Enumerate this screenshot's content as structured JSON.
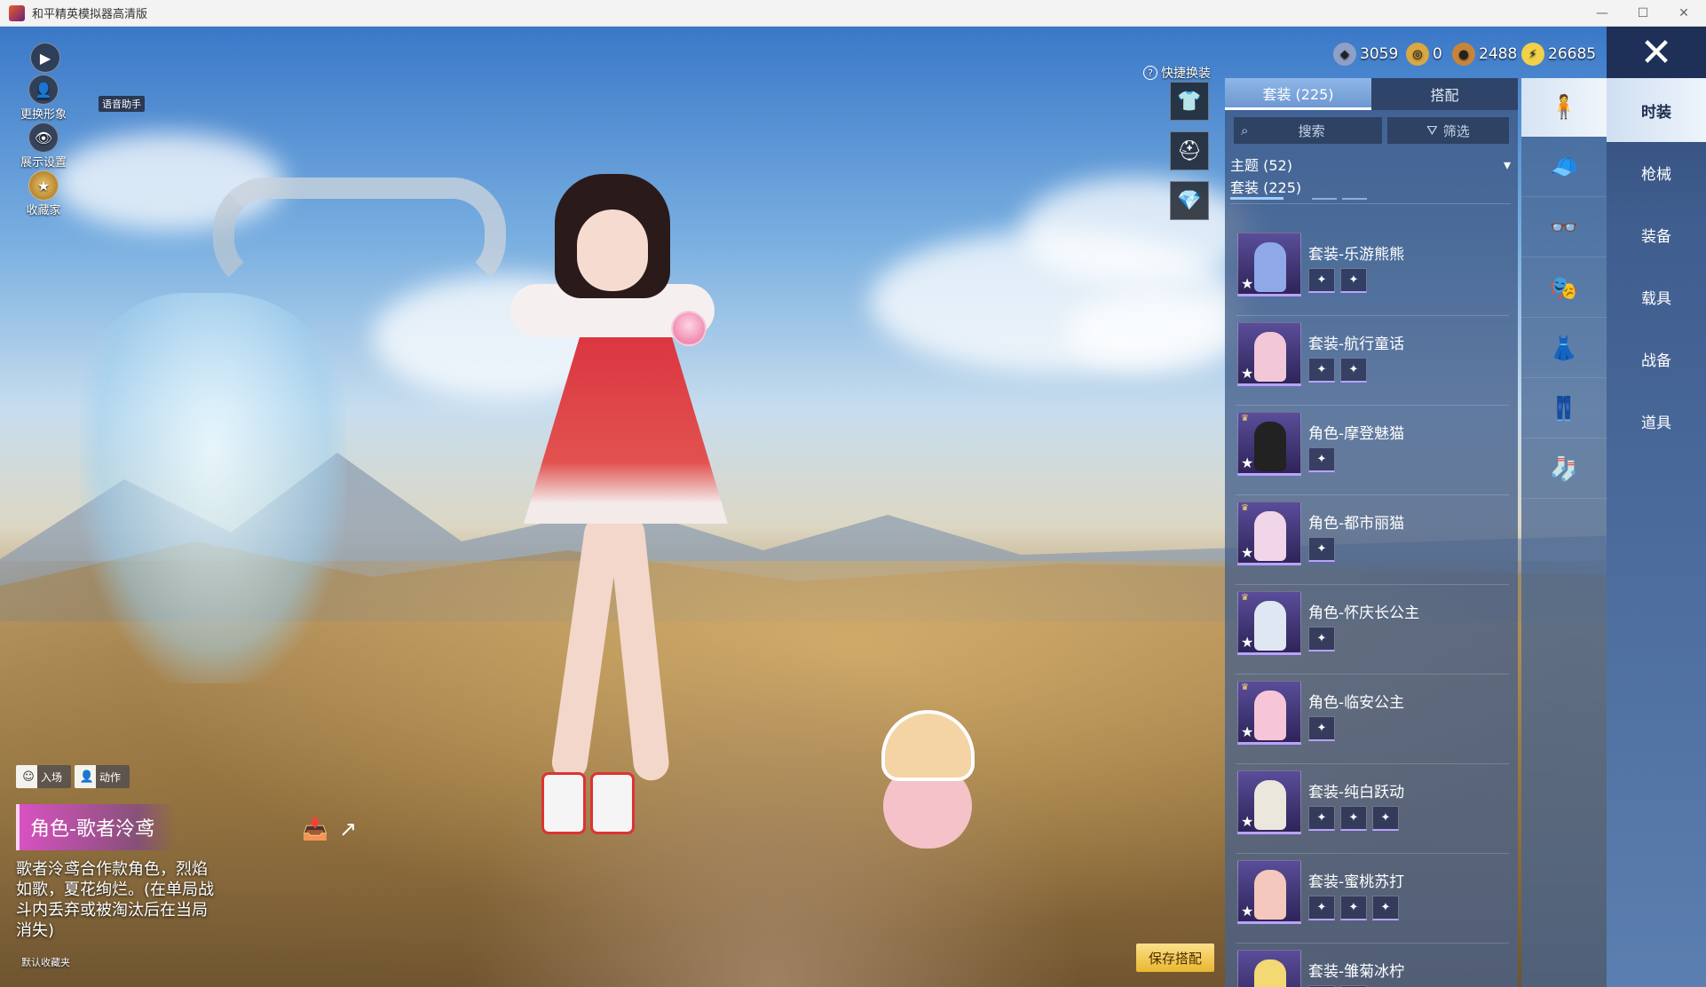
{
  "window": {
    "title": "和平精英模拟器高清版",
    "minimize": "—",
    "maximize": "☐",
    "close": "✕"
  },
  "left_hud": {
    "change_avatar": "更换形象",
    "display_settings": "展示设置",
    "collector": "收藏家",
    "voice_assistant": "语音助手"
  },
  "tags": {
    "entrance": "入场",
    "action": "动作"
  },
  "character": {
    "name": "角色-歌者泠鸢",
    "description": "歌者泠鸢合作款角色，烈焰如歌，夏花绚烂。(在单局战斗内丢弃或被淘汰后在当局消失)",
    "default_folder": "默认收藏夹"
  },
  "save_button": "保存搭配",
  "quick_change": {
    "label": "快捷换装",
    "icons": [
      "shirt-icon",
      "helmet-icon",
      "diamond-icon"
    ]
  },
  "currency": [
    {
      "icon": "silver-coin-icon",
      "value": "3059",
      "color": "#8fa0c8"
    },
    {
      "icon": "badge-coin-icon",
      "value": "0",
      "color": "#d8a842"
    },
    {
      "icon": "bronze-coin-icon",
      "value": "2488",
      "color": "#c8843a"
    },
    {
      "icon": "lightning-coin-icon",
      "value": "26685",
      "color": "#f2d04a"
    }
  ],
  "panel": {
    "tabs": [
      "套装 (225)",
      "搭配"
    ],
    "search_placeholder": "搜索",
    "filter_label": "筛选",
    "theme_label": "主题 (52)",
    "suit_label": "套装 (225)",
    "items": [
      {
        "title": "套装-乐游熊熊",
        "color": "#8fa8e8",
        "subicons": 2,
        "crown": false
      },
      {
        "title": "套装-航行童话",
        "color": "#f2c7d8",
        "subicons": 2,
        "crown": false
      },
      {
        "title": "角色-摩登魅猫",
        "color": "#222222",
        "subicons": 1,
        "crown": true
      },
      {
        "title": "角色-都市丽猫",
        "color": "#f0d6e8",
        "subicons": 1,
        "crown": true
      },
      {
        "title": "角色-怀庆长公主",
        "color": "#dfe7f3",
        "subicons": 1,
        "crown": true
      },
      {
        "title": "角色-临安公主",
        "color": "#f6c6d8",
        "subicons": 1,
        "crown": true
      },
      {
        "title": "套装-纯白跃动",
        "color": "#ece7dc",
        "subicons": 3,
        "crown": false
      },
      {
        "title": "套装-蜜桃苏打",
        "color": "#f4c8bc",
        "subicons": 3,
        "crown": false
      },
      {
        "title": "套装-雏菊冰柠",
        "color": "#f3d874",
        "subicons": 2,
        "crown": false
      }
    ]
  },
  "categories": [
    "character-icon",
    "cap-icon",
    "glasses-icon",
    "mask-icon",
    "outfit-icon",
    "pants-icon",
    "socks-icon"
  ],
  "rightnav": [
    "时装",
    "枪械",
    "装备",
    "载具",
    "战备",
    "道具"
  ]
}
